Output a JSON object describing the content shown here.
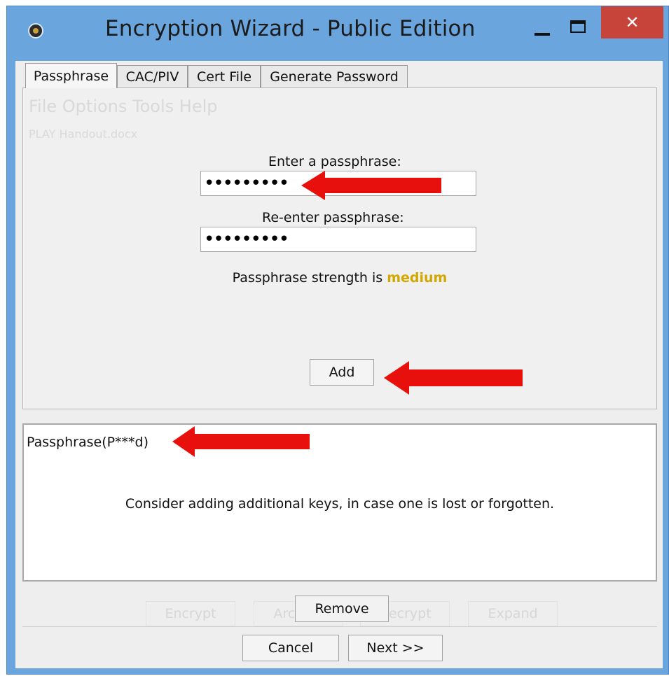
{
  "window": {
    "title": "Encryption Wizard - Public Edition",
    "close_glyph": "✕"
  },
  "tabs": [
    {
      "label": "Passphrase",
      "active": true
    },
    {
      "label": "CAC/PIV",
      "active": false
    },
    {
      "label": "Cert File",
      "active": false
    },
    {
      "label": "Generate Password",
      "active": false
    }
  ],
  "background_ghost": {
    "menu": "File  Options  Tools  Help",
    "file": "PLAY Handout.docx",
    "buttons": [
      "Encrypt",
      "Archive",
      "Decrypt",
      "Expand"
    ]
  },
  "form": {
    "enter_label": "Enter a passphrase:",
    "enter_value": "•••••••••",
    "reenter_label": "Re-enter passphrase:",
    "reenter_value": "•••••••••",
    "strength_prefix": "Passphrase strength is ",
    "strength_value": "medium",
    "add_button": "Add"
  },
  "keys": {
    "items": [
      "Passphrase(P***d)"
    ],
    "hint": "Consider adding additional keys, in case one is lost or forgotten."
  },
  "actions": {
    "remove": "Remove",
    "cancel": "Cancel",
    "next": "Next >>"
  },
  "colors": {
    "titlebar": "#6aa6dd",
    "close": "#c7443a",
    "strength": "#d2a700",
    "annotation_arrow": "#e8100c"
  },
  "icons": {
    "app": "app-icon",
    "minimize": "minimize-icon",
    "maximize": "maximize-icon",
    "close": "close-icon",
    "annotation": "red-arrow-icon"
  }
}
